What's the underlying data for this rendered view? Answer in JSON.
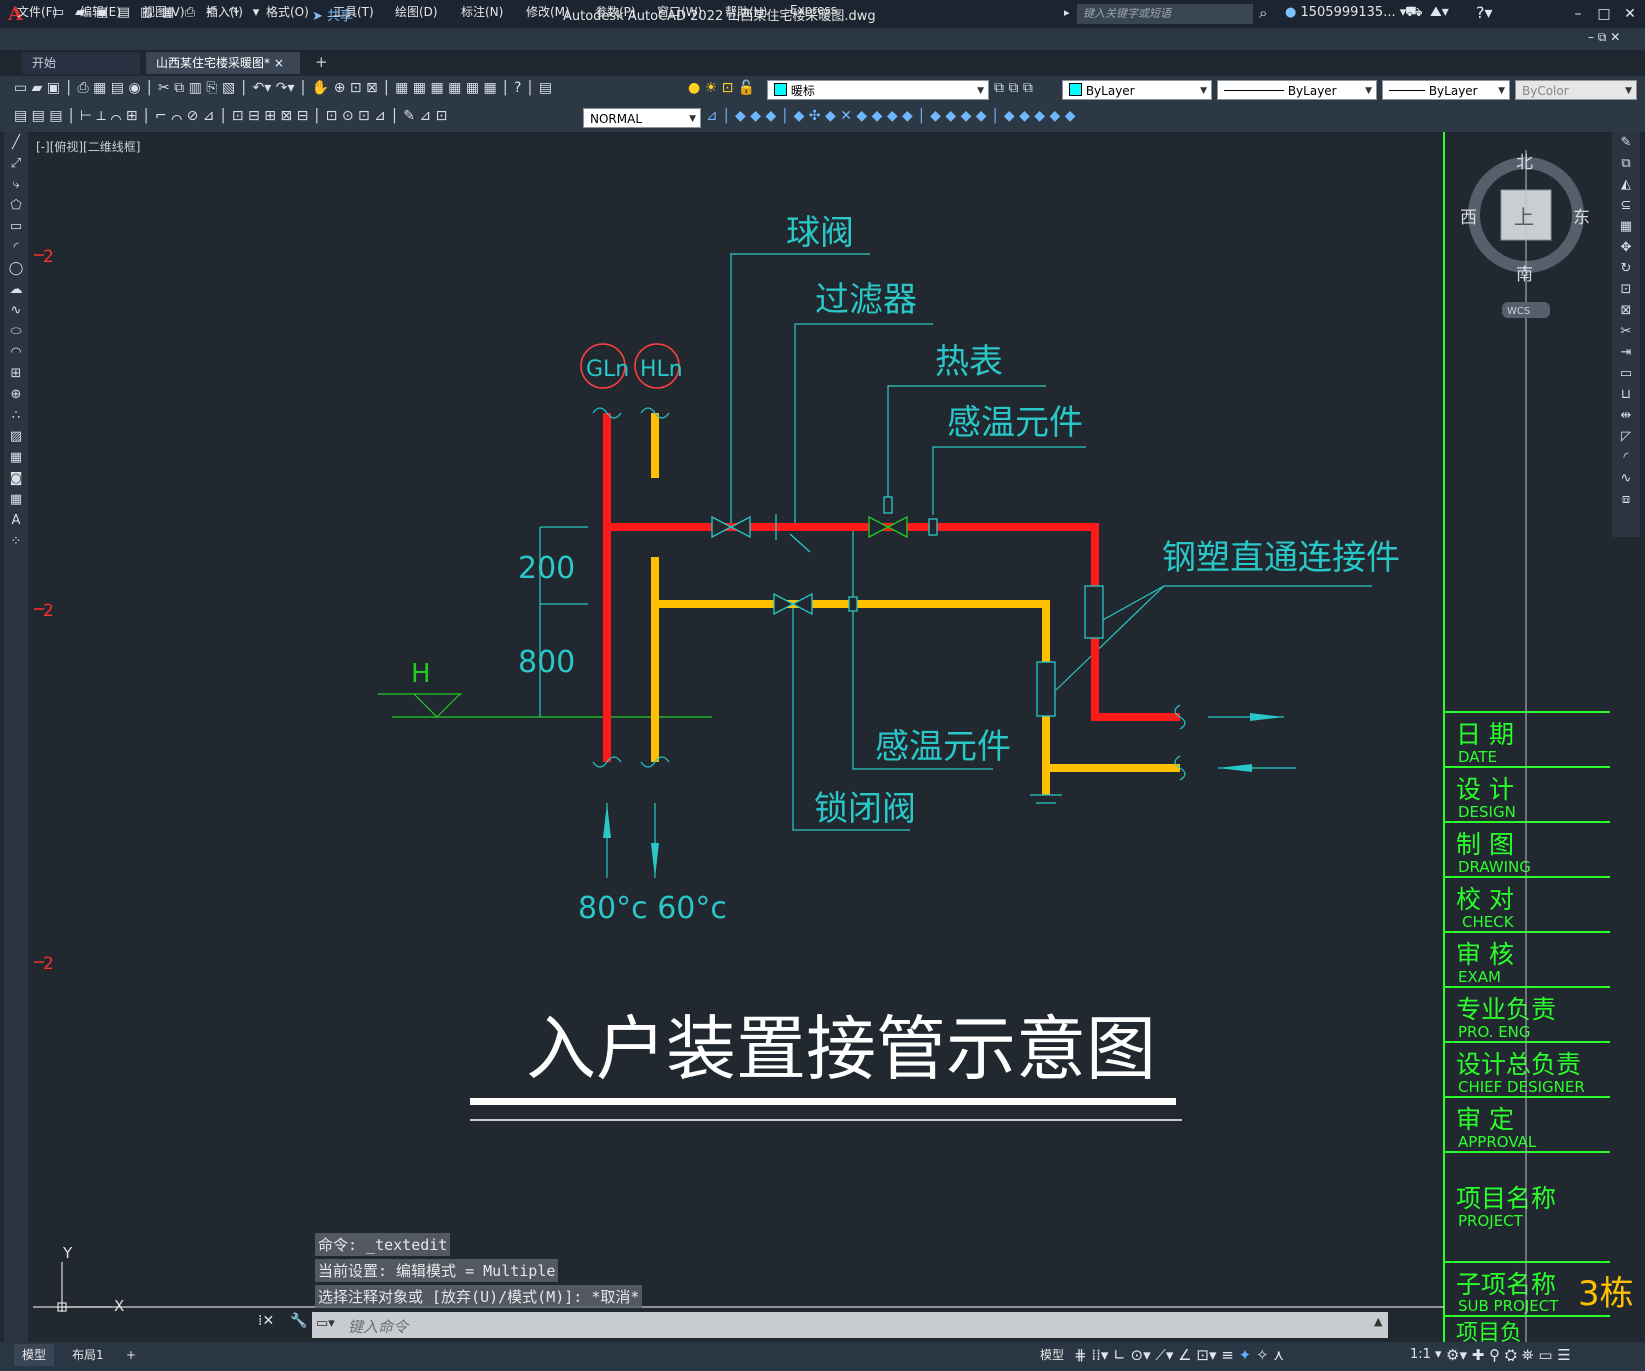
{
  "titlebar": {
    "logo": "A",
    "share": "共享",
    "app_title": "Autodesk AutoCAD 2022    山西某住宅楼采暖图.dwg",
    "search_placeholder": "键入关键字或短语",
    "user": "1505999135..."
  },
  "menus": [
    "文件(F)",
    "编辑(E)",
    "视图(V)",
    "插入(I)",
    "格式(O)",
    "工具(T)",
    "绘图(D)",
    "标注(N)",
    "修改(M)",
    "参数(P)",
    "窗口(W)",
    "帮助(H)",
    "Express"
  ],
  "tabs": {
    "start": "开始",
    "active": "山西某住宅楼采暖图*",
    "close": "×",
    "add": "+"
  },
  "toolbar": {
    "layer": "暖标",
    "color": "ByLayer",
    "linetype": "ByLayer",
    "lineweight": "ByLayer",
    "plotstyle": "ByColor",
    "dimstyle": "NORMAL"
  },
  "viewport_label": "[-][俯视][二维线框]",
  "viewcube": {
    "north": "北",
    "south": "南",
    "east": "东",
    "west": "西",
    "top": "上",
    "wcs": "WCS"
  },
  "drawing": {
    "labels": {
      "ball_valve": "球阀",
      "filter": "过滤器",
      "heat_meter": "热表",
      "temp_sensor_top": "感温元件",
      "steel_plastic": "钢塑直通连接件",
      "temp_sensor_bottom": "感温元件",
      "lock_valve": "锁闭阀",
      "gln": "GLn",
      "hln": "HLn",
      "dim_200": "200",
      "dim_800": "800",
      "level_h": "H",
      "temps": "80°c 60°c"
    },
    "title": "入户装置接管示意图",
    "break_mark": "2",
    "axis_y": "Y",
    "axis_x": "X"
  },
  "titleblock": [
    {
      "cn": "日  期",
      "en": "DATE"
    },
    {
      "cn": "设  计",
      "en": "DESIGN"
    },
    {
      "cn": "制  图",
      "en": "DRAWING"
    },
    {
      "cn": "校  对",
      "en": "CHECK"
    },
    {
      "cn": "审  核",
      "en": "EXAM"
    },
    {
      "cn": "专业负责",
      "en": "PRO. ENG"
    },
    {
      "cn": "设计总负责",
      "en": "CHIEF DESIGNER"
    },
    {
      "cn": "审  定",
      "en": "APPROVAL"
    },
    {
      "cn": "项目名称",
      "en": "PROJECT"
    },
    {
      "cn": "子项名称",
      "en": "SUB PROJECT"
    },
    {
      "cn": "项目负",
      "en": ""
    }
  ],
  "titleblock_extra": "3栋",
  "command": {
    "line1": "命令: _textedit",
    "line2": "当前设置: 编辑模式 = Multiple",
    "line3": "选择注释对象或 [放弃(U)/模式(M)]: *取消*",
    "placeholder": "键入命令"
  },
  "statusbar": {
    "model_tab": "模型",
    "layout_tab": "布局1",
    "add": "+",
    "model": "模型",
    "scale": "1:1"
  },
  "colors": {
    "hot_pipe": "#ff1a1a",
    "return_pipe": "#ffc000",
    "annotation": "#29c7c7",
    "titleblock": "#2bff2b",
    "title_text": "#ffffff"
  }
}
